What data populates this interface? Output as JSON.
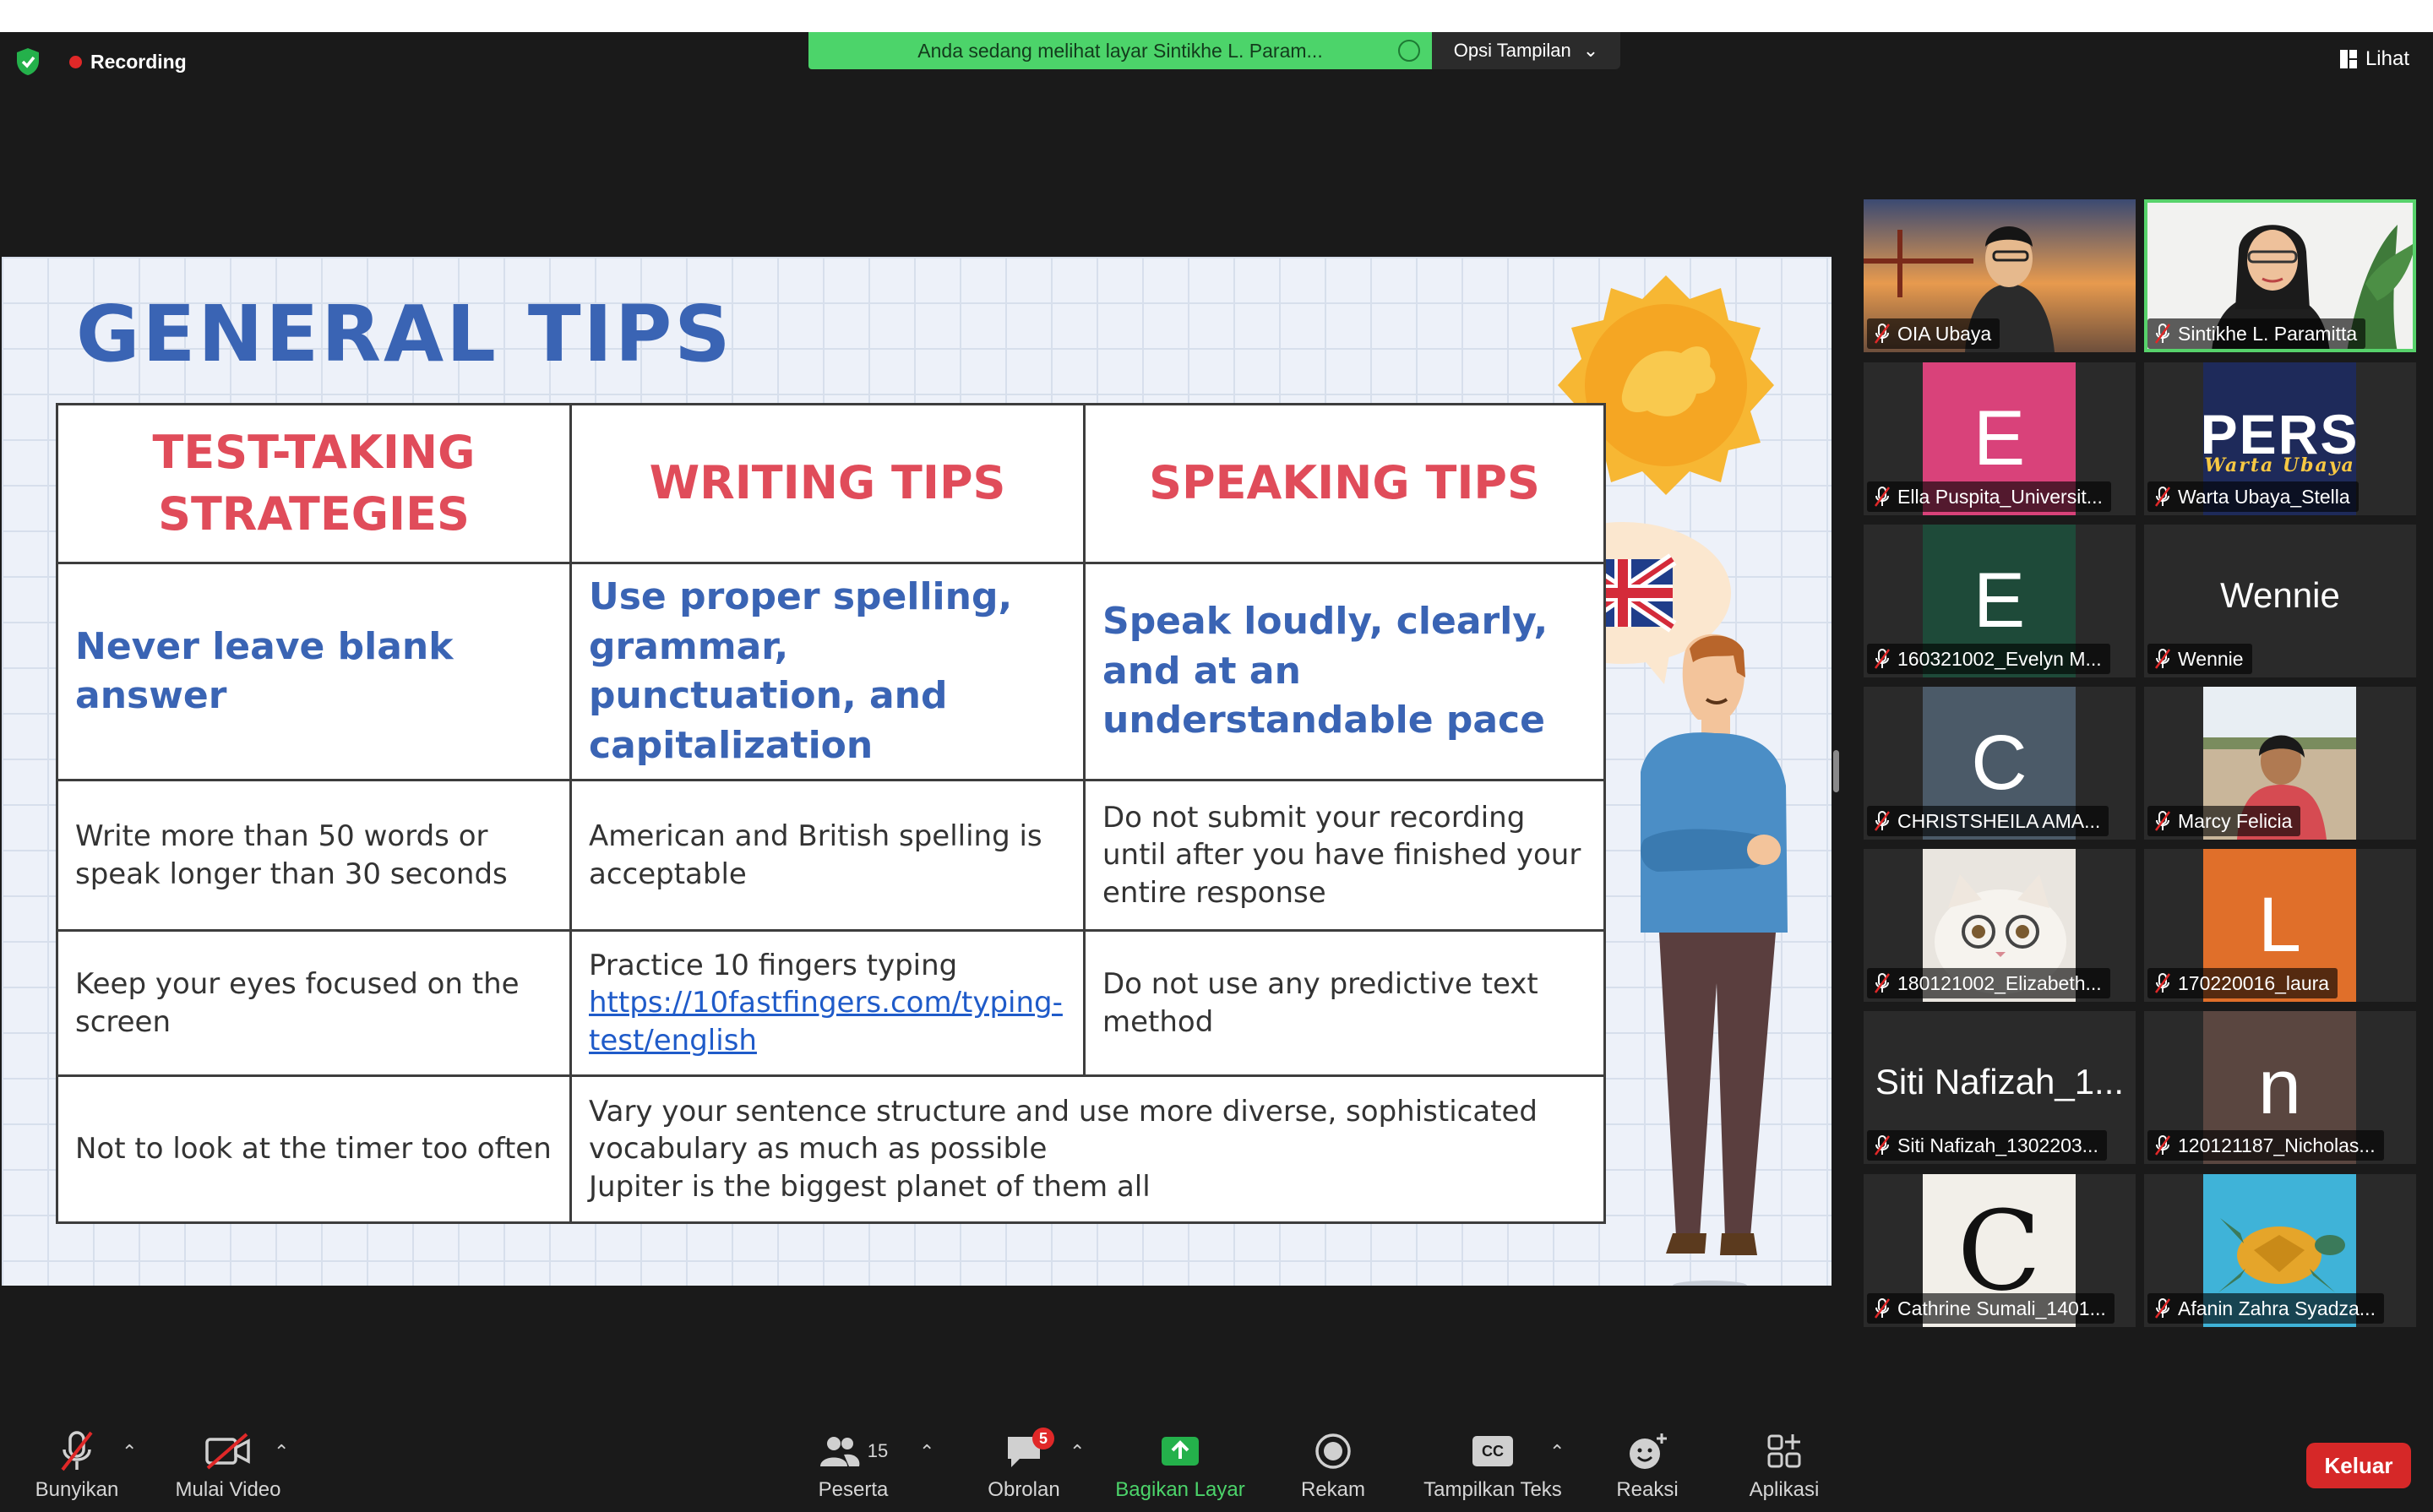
{
  "recording_label": "Recording",
  "share_banner": "Anda sedang melihat layar Sintikhe L. Param...",
  "view_options_label": "Opsi Tampilan",
  "view_label": "Lihat",
  "slide": {
    "title": "GENERAL TIPS",
    "headers": [
      "TEST-TAKING STRATEGIES",
      "WRITING TIPS",
      "SPEAKING TIPS"
    ],
    "bold_row": [
      "Never leave blank answer",
      "Use proper spelling, grammar, punctuation, and capitalization",
      "Speak loudly, clearly, and at an understandable pace"
    ],
    "row3": [
      "Write more than 50 words or speak longer than 30 seconds",
      "American and British spelling is acceptable",
      "Do not submit your recording until after you have finished your entire response"
    ],
    "row4": [
      "Keep your eyes focused on the screen",
      "Practice 10 fingers typing",
      "https://10fastfingers.com/typing-test/english",
      "Do not use any predictive text method"
    ],
    "row5": [
      "Not to look at the timer too often",
      "Vary your sentence structure and use more diverse, sophisticated vocabulary as much as possible",
      "Jupiter is the biggest planet of them all"
    ]
  },
  "participants": [
    {
      "name": "OIA Ubaya",
      "type": "video"
    },
    {
      "name": "Sintikhe L. Paramitta",
      "type": "video"
    },
    {
      "name": "Ella Puspita_Universit...",
      "initial": "E",
      "color": "#d9427a"
    },
    {
      "name": "Warta Ubaya_Stella",
      "logo": "PERS",
      "logo_sub": "Warta Ubaya",
      "color": "#1e2a5a"
    },
    {
      "name": "160321002_Evelyn M...",
      "initial": "E",
      "color": "#1e4a39"
    },
    {
      "name": "Wennie",
      "big": "Wennie"
    },
    {
      "name": "CHRISTSHEILA AMA...",
      "initial": "C",
      "color": "#4b5a68"
    },
    {
      "name": "Marcy Felicia",
      "type": "photo"
    },
    {
      "name": "180121002_Elizabeth...",
      "type": "cat"
    },
    {
      "name": "170220016_laura",
      "initial": "L",
      "color": "#e06f2a"
    },
    {
      "name": "Siti Nafizah_1302203...",
      "big": "Siti Nafizah_1..."
    },
    {
      "name": "120121187_Nicholas...",
      "initial": "n",
      "color": "#5a4640"
    },
    {
      "name": "Cathrine Sumali_1401...",
      "initial": "C",
      "color": "#f2efe9"
    },
    {
      "name": "Afanin Zahra Syadza...",
      "type": "turtle"
    }
  ],
  "toolbar": {
    "unmute": "Bunyikan",
    "start_video": "Mulai Video",
    "participants": "Peserta",
    "participants_count": "15",
    "chat": "Obrolan",
    "chat_badge": "5",
    "share": "Bagikan Layar",
    "record": "Rekam",
    "captions": "Tampilkan Teks",
    "cc": "CC",
    "reactions": "Reaksi",
    "apps": "Aplikasi",
    "leave": "Keluar"
  },
  "colors": {
    "accent_green": "#4cd46a",
    "slide_blue": "#3a64b4",
    "slide_red": "#e04c5a",
    "leave_red": "#d62828"
  }
}
